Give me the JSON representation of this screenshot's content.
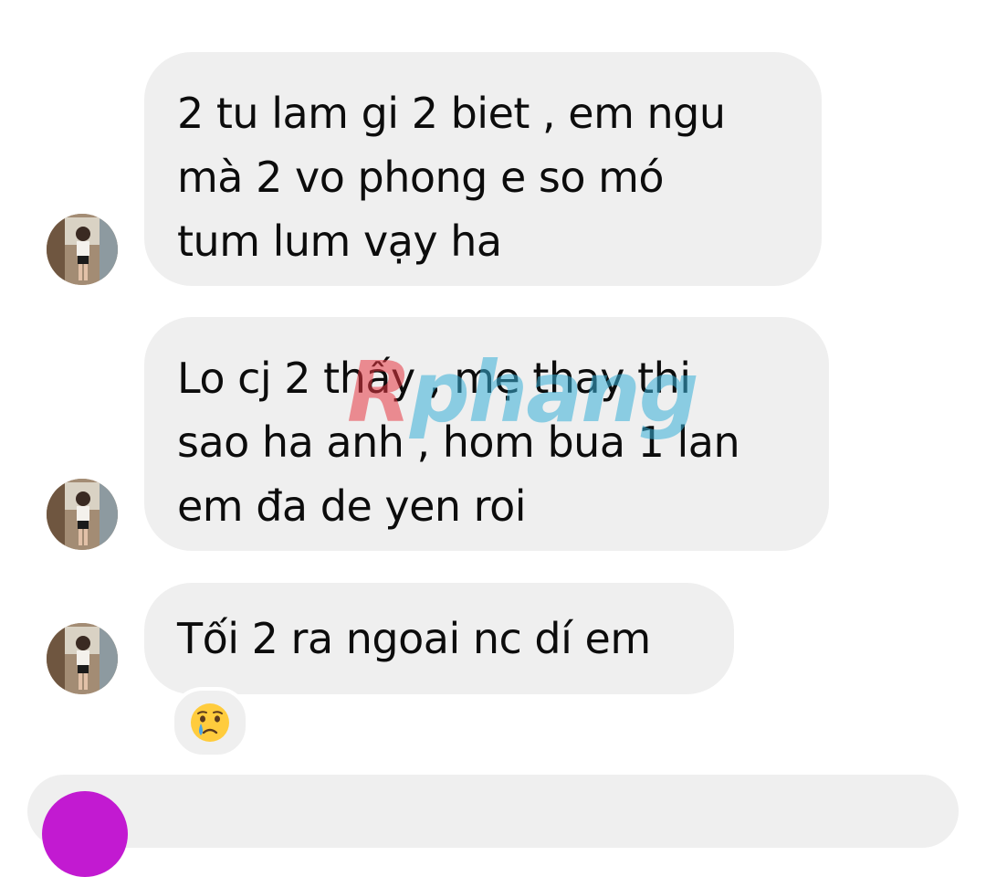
{
  "conversation": {
    "messages": [
      {
        "sender": "other",
        "lines": [
          "2 tu lam gi 2 biet , em ngu",
          "mà 2 vo phong e so mó",
          "tum lum vạy ha"
        ]
      },
      {
        "sender": "other",
        "lines": [
          "Lo cj 2 thấy , mẹ thay thi",
          "sao ha anh , hom bua 1 lan",
          "em đa de yen roi"
        ]
      },
      {
        "sender": "other",
        "lines": [
          "Tối 2 ra ngoai nc dí em"
        ],
        "reaction": "😢"
      }
    ]
  },
  "watermark": {
    "first_letter": "R",
    "rest": "phang"
  },
  "icons": {
    "avatar": "profile-photo",
    "reaction": "crying-face-emoji",
    "composer_button": "camera-button"
  },
  "colors": {
    "bubble": "#efefef",
    "text": "#0c0c0c",
    "composer_accent": "#c21ad1"
  }
}
